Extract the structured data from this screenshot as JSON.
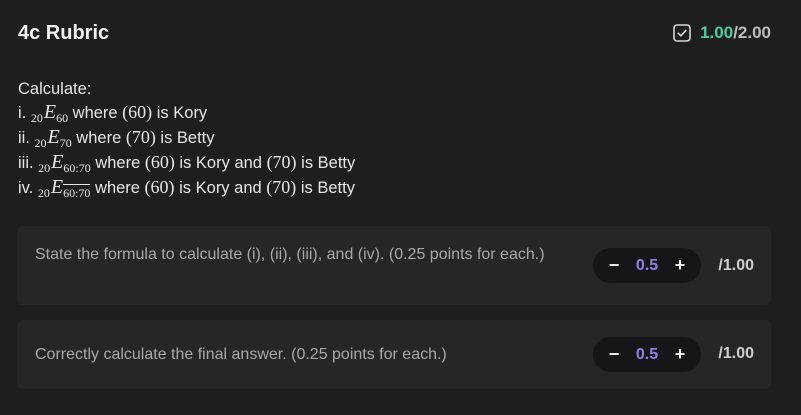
{
  "header": {
    "title": "4c Rubric",
    "score_earned": "1.00",
    "score_total": "/2.00",
    "icon": "checkbox-icon",
    "accent": "#3fd39c"
  },
  "question": {
    "intro": "Calculate:",
    "items": [
      {
        "prefix": "i. ",
        "pre": "20",
        "var": "E",
        "post": "60",
        "bar": false,
        "text1": " where ",
        "num1": "(60)",
        "text2": " is Kory",
        "num2": "",
        "text3": ""
      },
      {
        "prefix": "ii. ",
        "pre": "20",
        "var": "E",
        "post": "70",
        "bar": false,
        "text1": " where ",
        "num1": "(70)",
        "text2": " is Betty",
        "num2": "",
        "text3": ""
      },
      {
        "prefix": "iii. ",
        "pre": "20",
        "var": "E",
        "post": "60:70",
        "bar": false,
        "text1": " where ",
        "num1": "(60)",
        "text2": " is Kory and ",
        "num2": "(70)",
        "text3": " is Betty"
      },
      {
        "prefix": "iv. ",
        "pre": "20",
        "var": "E",
        "post": "60:70",
        "bar": true,
        "text1": " where ",
        "num1": "(60)",
        "text2": " is Kory and ",
        "num2": "(70)",
        "text3": " is Betty"
      }
    ]
  },
  "criteria": [
    {
      "text": "State the formula to calculate (i), (ii), (iii), and (iv). (0.25 points for each.)",
      "value": "0.5",
      "minus": "−",
      "plus": "+",
      "max": "/1.00"
    },
    {
      "text": "Correctly calculate the final answer. (0.25 points for each.)",
      "value": "0.5",
      "minus": "−",
      "plus": "+",
      "max": "/1.00"
    }
  ],
  "colors": {
    "background": "#1e1e20",
    "card": "#262629",
    "stepper_value": "#8f7fe6"
  }
}
